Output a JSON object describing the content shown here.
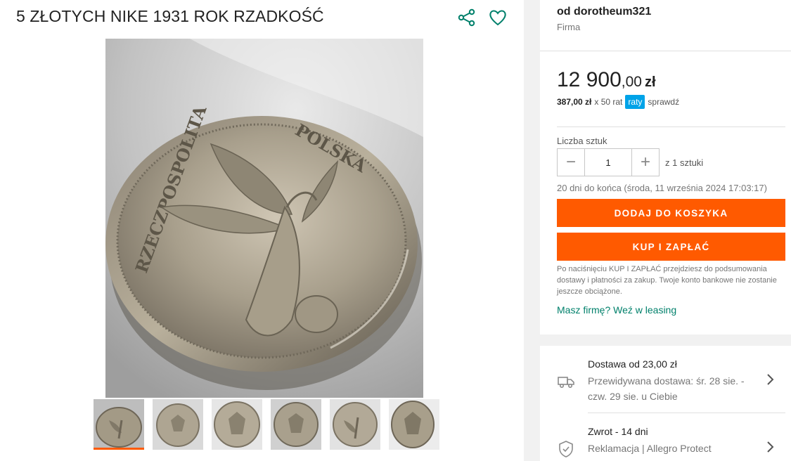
{
  "listing": {
    "title": "5 ZŁOTYCH NIKE 1931 ROK RZADKOŚĆ",
    "share_icon": "share-icon",
    "favorite_icon": "heart-icon",
    "main_photo_icon": "coin-photo",
    "thumbnails": [
      {
        "name": "thumb-1",
        "active": true
      },
      {
        "name": "thumb-2",
        "active": false
      },
      {
        "name": "thumb-3",
        "active": false
      },
      {
        "name": "thumb-4",
        "active": false
      },
      {
        "name": "thumb-5",
        "active": false
      },
      {
        "name": "thumb-6",
        "active": false
      }
    ]
  },
  "seller": {
    "name": "od dorotheum321",
    "type": "Firma"
  },
  "price": {
    "integer": "12 900",
    "decimals": ",00",
    "currency": "zł",
    "installment_amount": "387,00 zł",
    "installment_count": "x 50 rat",
    "installment_badge": "raty",
    "installment_check": "sprawdź"
  },
  "quantity": {
    "label": "Liczba sztuk",
    "value": "1",
    "of_text": "z 1 sztuki",
    "minus": "−",
    "plus": "+"
  },
  "ends_text": "20 dni do końca (środa, 11 września 2024 17:03:17)",
  "actions": {
    "add_to_cart": "DODAJ DO KOSZYKA",
    "buy_now": "KUP I ZAPŁAĆ"
  },
  "notice": "Po naciśnięciu KUP I ZAPŁAĆ przejdziesz do podsumowania dostawy i płatności za zakup. Twoje konto bankowe nie zostanie jeszcze obciążone.",
  "leasing_link": "Masz firmę? Weź w leasing",
  "delivery": {
    "title": "Dostawa od 23,00 zł",
    "subtitle": "Przewidywana dostawa: śr. 28 sie. - czw. 29 sie. u Ciebie",
    "icon": "truck-icon"
  },
  "returns": {
    "title": "Zwrot - 14 dni",
    "subtitle": "Reklamacja | Allegro Protect",
    "icon": "shield-icon"
  },
  "colors": {
    "accent": "#ff5a00",
    "raty": "#00a3e8",
    "link": "#00806b"
  }
}
